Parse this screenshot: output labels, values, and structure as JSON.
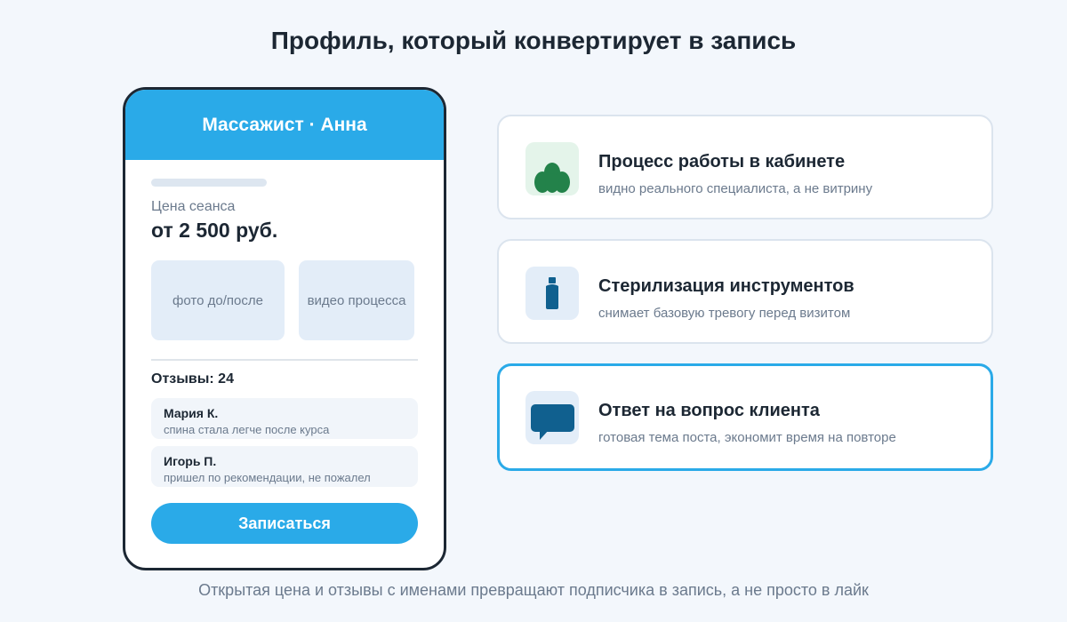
{
  "title": "Профиль, который конвертирует в запись",
  "phone": {
    "header": "Массажист · Анна",
    "price_label": "Цена сеанса",
    "price_value": "от 2 500 руб.",
    "media": [
      "фото до/после",
      "видео процесса"
    ],
    "reviews_heading": "Отзывы: 24",
    "reviews": [
      {
        "name": "Мария К.",
        "text": "спина стала легче после курса"
      },
      {
        "name": "Игорь П.",
        "text": "пришел по рекомендации, не пожалел"
      }
    ],
    "book_button": "Записаться"
  },
  "features": [
    {
      "icon": "trees-icon",
      "title": "Процесс работы в кабинете",
      "subtitle": "видно реального специалиста, а не витрину"
    },
    {
      "icon": "bottle-icon",
      "title": "Стерилизация инструментов",
      "subtitle": "снимает базовую тревогу перед визитом"
    },
    {
      "icon": "chat-bubble-icon",
      "title": "Ответ на вопрос клиента",
      "subtitle": "готовая тема поста, экономит время на повторе",
      "highlighted": true
    }
  ],
  "footer": "Открытая цена и отзывы с именами превращают подписчика в запись, а не просто в лайк",
  "colors": {
    "accent": "#2aaae8",
    "dark": "#1c2733",
    "muted": "#6b7a8d",
    "green": "#23824a",
    "navy": "#10608f"
  }
}
